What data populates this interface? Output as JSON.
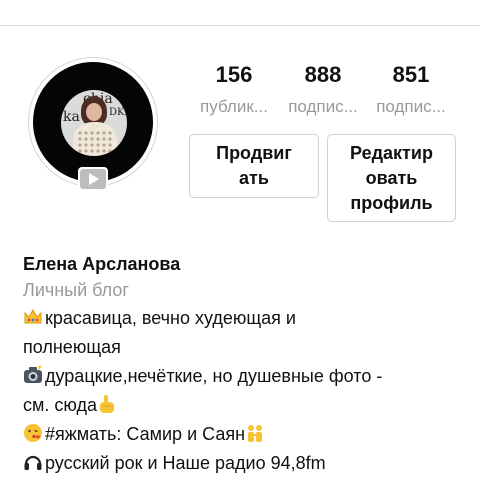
{
  "profile": {
    "avatar_text": {
      "word_top": "chia",
      "word_left": "ka",
      "word_right": "DKEN"
    },
    "has_video_badge": true
  },
  "stats": [
    {
      "count": "156",
      "label": "публик..."
    },
    {
      "count": "888",
      "label": "подпис..."
    },
    {
      "count": "851",
      "label": "подпис..."
    }
  ],
  "actions": {
    "promote_line1": "Продвиг",
    "promote_line2": "ать",
    "edit_line1": "Редактир",
    "edit_line2": "овать",
    "edit_line3": "профиль"
  },
  "bio": {
    "name": "Елена Арсланова",
    "category": "Личный блог",
    "lines": [
      {
        "icon": "crown-icon",
        "text": "красавица, вечно худеющая и"
      },
      {
        "icon": "",
        "text": "полнеющая"
      },
      {
        "icon": "camera-flash-icon",
        "text": "дурацкие,нечёткие, но душевные фото -"
      },
      {
        "icon": "",
        "text": "см. сюда",
        "trailing_icon": "pointing-hand-icon"
      },
      {
        "icon": "kissing-face-icon",
        "text": "#яжмать: Самир и Саян",
        "trailing_icon": "boy-and-girl-icon"
      },
      {
        "icon": "headphones-icon",
        "text": "русский рок и Наше радио 94,8fm"
      }
    ]
  },
  "colors": {
    "muted_text": "#9a9a9a",
    "border": "#d2d2d2",
    "avatar_ring": "#050505",
    "emoji_yellow": "#f7c335"
  }
}
